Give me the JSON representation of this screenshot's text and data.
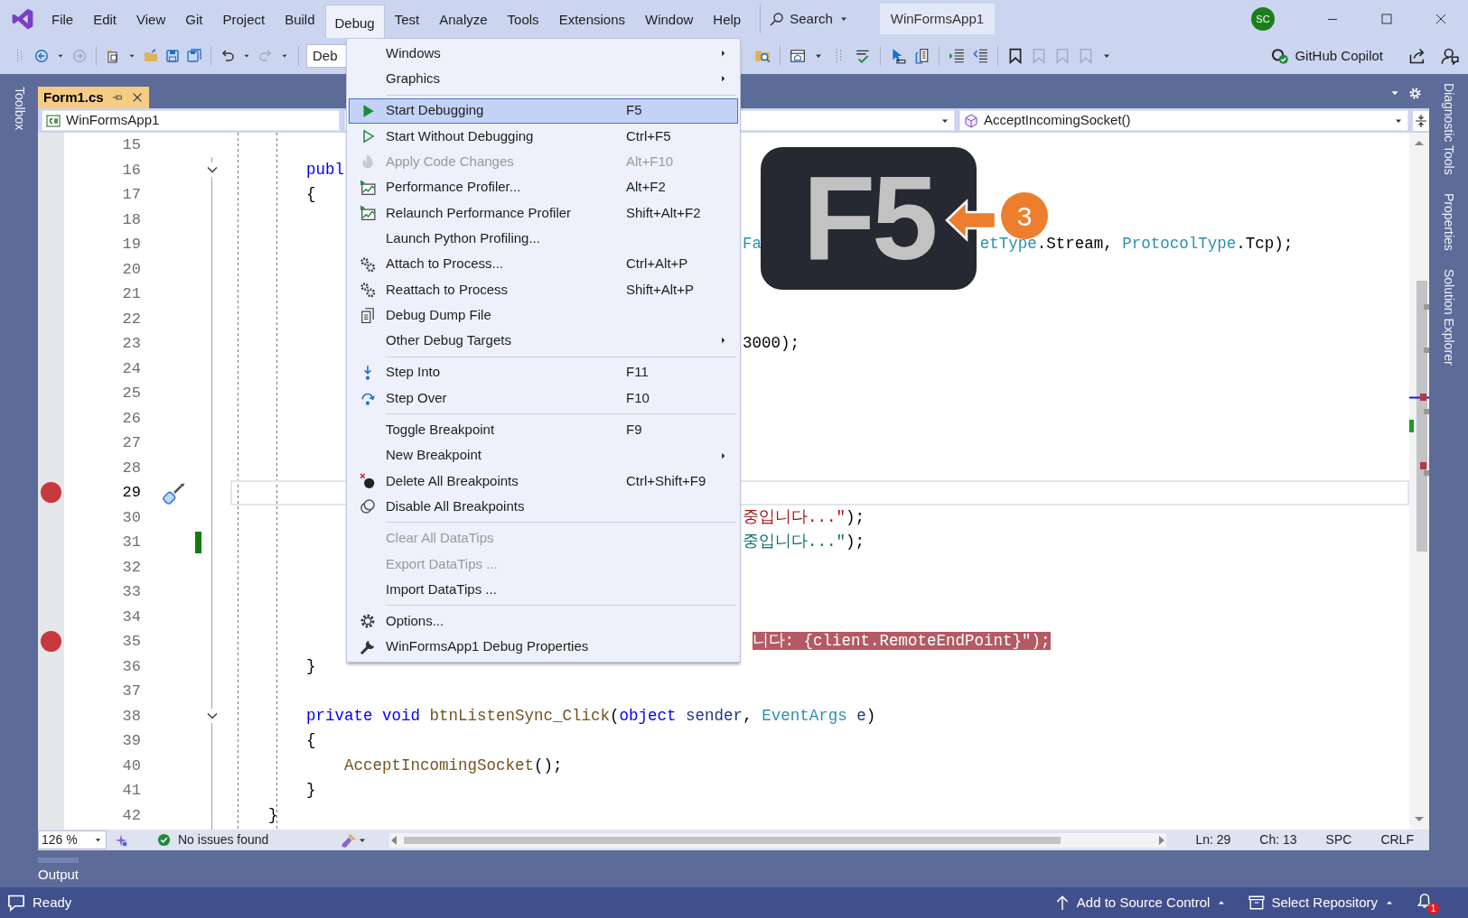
{
  "window": {
    "title": "WinFormsApp1",
    "user_initials": "SC"
  },
  "menu_bar": [
    {
      "label": "File",
      "selected": false
    },
    {
      "label": "Edit",
      "selected": false
    },
    {
      "label": "View",
      "selected": false
    },
    {
      "label": "Git",
      "selected": false
    },
    {
      "label": "Project",
      "selected": false
    },
    {
      "label": "Build",
      "selected": false
    },
    {
      "label": "Debug",
      "selected": true
    },
    {
      "label": "Test",
      "selected": false
    },
    {
      "label": "Analyze",
      "selected": false
    },
    {
      "label": "Tools",
      "selected": false
    },
    {
      "label": "Extensions",
      "selected": false
    },
    {
      "label": "Window",
      "selected": false
    },
    {
      "label": "Help",
      "selected": false
    }
  ],
  "search": {
    "label": "Search"
  },
  "toolbar": {
    "configuration": "Deb",
    "copilot": "GitHub Copilot"
  },
  "document_tabs": [
    {
      "label": "Form1.cs",
      "selected": true
    }
  ],
  "navigation_bar": {
    "project": "WinFormsApp1",
    "member": "AcceptIncomingSocket()"
  },
  "editor": {
    "lines": [
      {
        "number": "15",
        "breakpoint": false,
        "current": false,
        "highlighted": false,
        "changed": false,
        "quick_action": false,
        "fold": false
      },
      {
        "number": "16",
        "breakpoint": false,
        "current": false,
        "highlighted": false,
        "changed": false,
        "quick_action": false,
        "fold": true,
        "parts": [
          {
            "tokens": [
              {
                "text": "    publ",
                "kind": "keyword"
              }
            ]
          }
        ]
      },
      {
        "number": "17",
        "breakpoint": false,
        "current": false,
        "highlighted": false,
        "changed": false,
        "quick_action": false,
        "fold": false,
        "parts": [
          {
            "tokens": [
              {
                "text": "    {",
                "kind": "plain"
              }
            ]
          }
        ]
      },
      {
        "number": "18",
        "breakpoint": false,
        "current": false,
        "highlighted": false,
        "changed": false,
        "quick_action": false,
        "fold": false
      },
      {
        "number": "19",
        "breakpoint": false,
        "current": false,
        "highlighted": false,
        "changed": false,
        "quick_action": false,
        "fold": false,
        "parts": [
          {
            "tokens": [
              {
                "text": "                                                  Fa",
                "kind": "type"
              }
            ]
          },
          {
            "tokens": [
              {
                "text": "                       etType",
                "kind": "type"
              },
              {
                "text": ".Stream, ",
                "kind": "plain"
              },
              {
                "text": "ProtocolType",
                "kind": "type"
              },
              {
                "text": ".Tcp);",
                "kind": "plain"
              }
            ]
          }
        ]
      },
      {
        "number": "20",
        "breakpoint": false,
        "current": false,
        "highlighted": false,
        "changed": false,
        "quick_action": false,
        "fold": false
      },
      {
        "number": "21",
        "breakpoint": false,
        "current": false,
        "highlighted": false,
        "changed": false,
        "quick_action": false,
        "fold": false
      },
      {
        "number": "22",
        "breakpoint": false,
        "current": false,
        "highlighted": false,
        "changed": false,
        "quick_action": false,
        "fold": false
      },
      {
        "number": "23",
        "breakpoint": false,
        "current": false,
        "highlighted": false,
        "changed": false,
        "quick_action": false,
        "fold": false,
        "parts": [
          {
            "tokens": [
              {
                "text": "                                                  3000);",
                "kind": "plain"
              }
            ]
          }
        ]
      },
      {
        "number": "24",
        "breakpoint": false,
        "current": false,
        "highlighted": false,
        "changed": false,
        "quick_action": false,
        "fold": false
      },
      {
        "number": "25",
        "breakpoint": false,
        "current": false,
        "highlighted": false,
        "changed": false,
        "quick_action": false,
        "fold": false
      },
      {
        "number": "26",
        "breakpoint": false,
        "current": false,
        "highlighted": false,
        "changed": false,
        "quick_action": false,
        "fold": false
      },
      {
        "number": "27",
        "breakpoint": false,
        "current": false,
        "highlighted": false,
        "changed": false,
        "quick_action": false,
        "fold": false
      },
      {
        "number": "28",
        "breakpoint": false,
        "current": false,
        "highlighted": false,
        "changed": false,
        "quick_action": false,
        "fold": false
      },
      {
        "number": "29",
        "breakpoint": true,
        "current": true,
        "highlighted": false,
        "changed": false,
        "quick_action": true,
        "fold": false
      },
      {
        "number": "30",
        "breakpoint": false,
        "current": false,
        "highlighted": false,
        "changed": false,
        "quick_action": false,
        "fold": false,
        "parts": [
          {
            "tokens": [
              {
                "text": "                                                  중입니다...\"",
                "kind": "string"
              },
              {
                "text": ");",
                "kind": "plain"
              }
            ]
          }
        ]
      },
      {
        "number": "31",
        "breakpoint": false,
        "current": false,
        "highlighted": false,
        "changed": true,
        "quick_action": false,
        "fold": false,
        "parts": [
          {
            "tokens": [
              {
                "text": "                                                  중입니다...\"",
                "kind": "interpolated"
              },
              {
                "text": ");",
                "kind": "plain"
              }
            ]
          }
        ]
      },
      {
        "number": "32",
        "breakpoint": false,
        "current": false,
        "highlighted": false,
        "changed": false,
        "quick_action": false,
        "fold": false
      },
      {
        "number": "33",
        "breakpoint": false,
        "current": false,
        "highlighted": false,
        "changed": false,
        "quick_action": false,
        "fold": false
      },
      {
        "number": "34",
        "breakpoint": false,
        "current": false,
        "highlighted": false,
        "changed": false,
        "quick_action": false,
        "fold": false
      },
      {
        "number": "35",
        "breakpoint": true,
        "current": false,
        "highlighted": true,
        "changed": false,
        "quick_action": false,
        "fold": false,
        "parts": [
          {
            "tokens": [
              {
                "text": "                                                   니다: {client.RemoteEndPoint}\");",
                "kind": "plain"
              }
            ]
          }
        ]
      },
      {
        "number": "36",
        "breakpoint": false,
        "current": false,
        "highlighted": false,
        "changed": false,
        "quick_action": false,
        "fold": false,
        "parts": [
          {
            "tokens": [
              {
                "text": "    }",
                "kind": "plain"
              }
            ]
          }
        ]
      },
      {
        "number": "37",
        "breakpoint": false,
        "current": false,
        "highlighted": false,
        "changed": false,
        "quick_action": false,
        "fold": false
      },
      {
        "number": "38",
        "breakpoint": false,
        "current": false,
        "highlighted": false,
        "changed": false,
        "quick_action": false,
        "fold": true,
        "parts": [
          {
            "tokens": [
              {
                "text": "    private void ",
                "kind": "keyword"
              },
              {
                "text": "btnListenSync_Click",
                "kind": "method"
              },
              {
                "text": "(",
                "kind": "plain"
              },
              {
                "text": "object ",
                "kind": "keyword"
              },
              {
                "text": "sender",
                "kind": "param"
              },
              {
                "text": ", ",
                "kind": "plain"
              },
              {
                "text": "EventArgs ",
                "kind": "type"
              },
              {
                "text": "e",
                "kind": "param"
              },
              {
                "text": ")",
                "kind": "plain"
              }
            ]
          }
        ]
      },
      {
        "number": "39",
        "breakpoint": false,
        "current": false,
        "highlighted": false,
        "changed": false,
        "quick_action": false,
        "fold": false,
        "parts": [
          {
            "tokens": [
              {
                "text": "    {",
                "kind": "plain"
              }
            ]
          }
        ]
      },
      {
        "number": "40",
        "breakpoint": false,
        "current": false,
        "highlighted": false,
        "changed": false,
        "quick_action": false,
        "fold": false,
        "parts": [
          {
            "tokens": [
              {
                "text": "        AcceptIncomingSocket",
                "kind": "method"
              },
              {
                "text": "();",
                "kind": "plain"
              }
            ]
          }
        ]
      },
      {
        "number": "41",
        "breakpoint": false,
        "current": false,
        "highlighted": false,
        "changed": false,
        "quick_action": false,
        "fold": false,
        "parts": [
          {
            "tokens": [
              {
                "text": "    }",
                "kind": "plain"
              }
            ]
          }
        ]
      },
      {
        "number": "42",
        "breakpoint": false,
        "current": false,
        "highlighted": false,
        "changed": false,
        "quick_action": false,
        "fold": false,
        "parts": [
          {
            "tokens": [
              {
                "text": "}",
                "kind": "plain"
              }
            ]
          }
        ]
      }
    ]
  },
  "debug_menu": [
    {
      "kind": "item",
      "label": "Windows",
      "submenu": true,
      "disabled": false,
      "selected": false
    },
    {
      "kind": "item",
      "label": "Graphics",
      "submenu": true,
      "disabled": false,
      "selected": false
    },
    {
      "kind": "separator"
    },
    {
      "kind": "item",
      "label": "Start Debugging",
      "shortcut": "F5",
      "submenu": false,
      "disabled": false,
      "selected": true
    },
    {
      "kind": "item",
      "label": "Start Without Debugging",
      "shortcut": "Ctrl+F5",
      "submenu": false,
      "disabled": false,
      "selected": false
    },
    {
      "kind": "item",
      "label": "Apply Code Changes",
      "shortcut": "Alt+F10",
      "submenu": false,
      "disabled": true,
      "selected": false
    },
    {
      "kind": "item",
      "label": "Performance Profiler...",
      "shortcut": "Alt+F2",
      "submenu": false,
      "disabled": false,
      "selected": false
    },
    {
      "kind": "item",
      "label": "Relaunch Performance Profiler",
      "shortcut": "Shift+Alt+F2",
      "submenu": false,
      "disabled": false,
      "selected": false
    },
    {
      "kind": "item",
      "label": "Launch Python Profiling...",
      "submenu": false,
      "disabled": false,
      "selected": false
    },
    {
      "kind": "item",
      "label": "Attach to Process...",
      "shortcut": "Ctrl+Alt+P",
      "submenu": false,
      "disabled": false,
      "selected": false
    },
    {
      "kind": "item",
      "label": "Reattach to Process",
      "shortcut": "Shift+Alt+P",
      "submenu": false,
      "disabled": false,
      "selected": false
    },
    {
      "kind": "item",
      "label": "Debug Dump File",
      "submenu": false,
      "disabled": false,
      "selected": false
    },
    {
      "kind": "item",
      "label": "Other Debug Targets",
      "submenu": true,
      "disabled": false,
      "selected": false
    },
    {
      "kind": "separator"
    },
    {
      "kind": "item",
      "label": "Step Into",
      "shortcut": "F11",
      "submenu": false,
      "disabled": false,
      "selected": false
    },
    {
      "kind": "item",
      "label": "Step Over",
      "shortcut": "F10",
      "submenu": false,
      "disabled": false,
      "selected": false
    },
    {
      "kind": "separator"
    },
    {
      "kind": "item",
      "label": "Toggle Breakpoint",
      "shortcut": "F9",
      "submenu": false,
      "disabled": false,
      "selected": false
    },
    {
      "kind": "item",
      "label": "New Breakpoint",
      "submenu": true,
      "disabled": false,
      "selected": false
    },
    {
      "kind": "item",
      "label": "Delete All Breakpoints",
      "shortcut": "Ctrl+Shift+F9",
      "submenu": false,
      "disabled": false,
      "selected": false
    },
    {
      "kind": "item",
      "label": "Disable All Breakpoints",
      "submenu": false,
      "disabled": false,
      "selected": false
    },
    {
      "kind": "separator"
    },
    {
      "kind": "item",
      "label": "Clear All DataTips",
      "submenu": false,
      "disabled": true,
      "selected": false
    },
    {
      "kind": "item",
      "label": "Export DataTips ...",
      "submenu": false,
      "disabled": true,
      "selected": false
    },
    {
      "kind": "item",
      "label": "Import DataTips ...",
      "submenu": false,
      "disabled": false,
      "selected": false
    },
    {
      "kind": "separator"
    },
    {
      "kind": "item",
      "label": "Options...",
      "submenu": false,
      "disabled": false,
      "selected": false
    },
    {
      "kind": "item",
      "label": "WinFormsApp1 Debug Properties",
      "submenu": false,
      "disabled": false,
      "selected": false
    }
  ],
  "shortcut_overlay": {
    "key": "F5",
    "step": "3"
  },
  "editor_status": {
    "zoom": "126 %",
    "issues": "No issues found",
    "line": "Ln: 29",
    "column": "Ch: 13",
    "whitespace": "SPC",
    "line_endings": "CRLF"
  },
  "tool_windows": {
    "left": [
      "Toolbox"
    ],
    "right": [
      "Diagnostic Tools",
      "Properties",
      "Solution Explorer"
    ],
    "bottom": [
      "Output"
    ]
  },
  "status_bar": {
    "text": "Ready",
    "source_control": "Add to Source Control",
    "repository": "Select Repository",
    "notifications": "1"
  }
}
